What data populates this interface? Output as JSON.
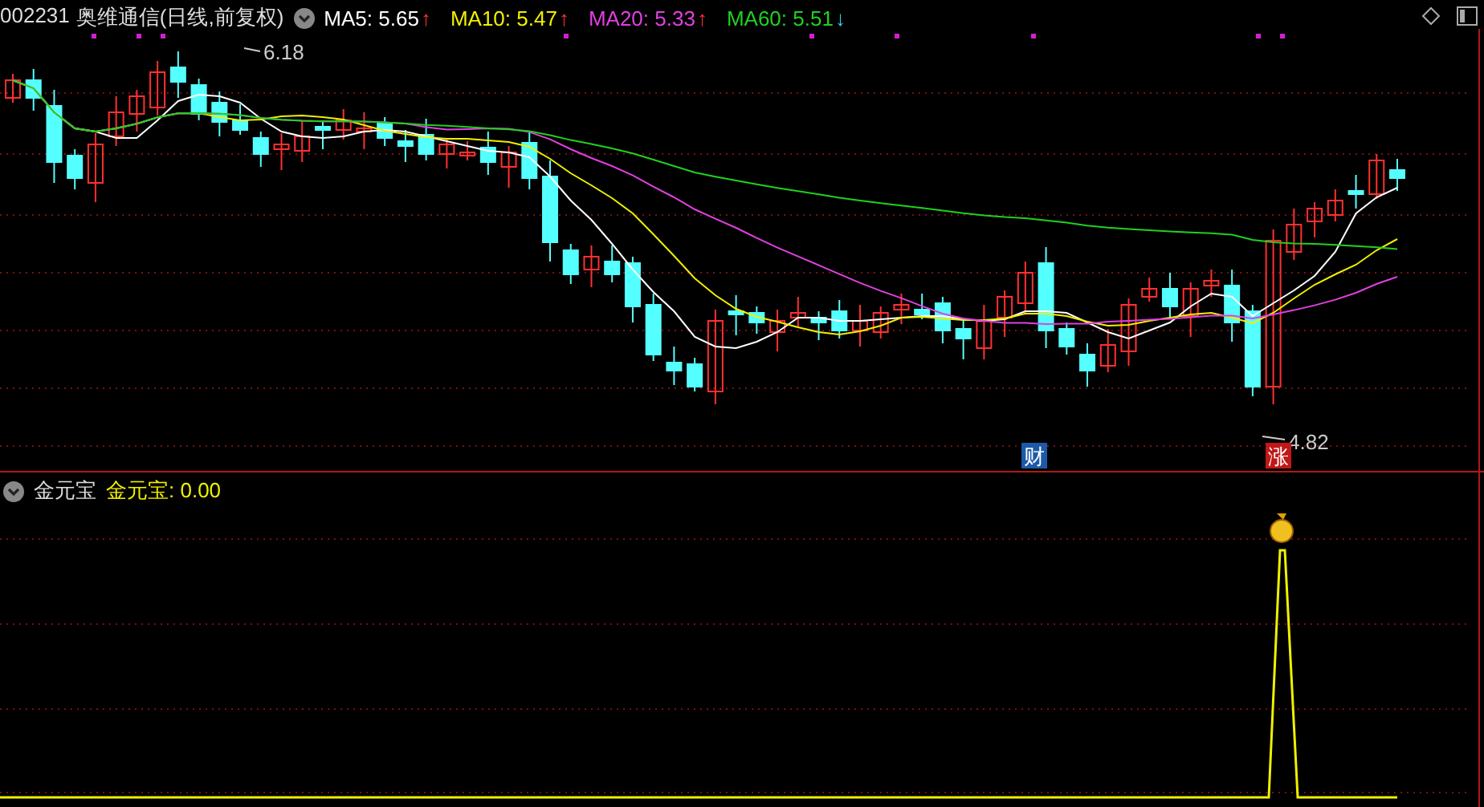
{
  "header": {
    "code": "002231",
    "name": "奥维通信",
    "period": "(日线,前复权)",
    "indicators": [
      {
        "label": "MA5: 5.65",
        "color": "#ffffff",
        "arrow": {
          "symbol": "↑",
          "color": "#ff3030"
        }
      },
      {
        "label": "MA10: 5.47",
        "color": "#f0f000",
        "arrow": {
          "symbol": "↑",
          "color": "#ff3030"
        }
      },
      {
        "label": "MA20: 5.33",
        "color": "#e040e0",
        "arrow": {
          "symbol": "↑",
          "color": "#ff3030"
        }
      },
      {
        "label": "MA60: 5.51",
        "color": "#20d020",
        "arrow": {
          "symbol": "↓",
          "color": "#30d0f0"
        }
      }
    ]
  },
  "price_chart": {
    "high_label": "6.18",
    "low_label": "4.82",
    "markers": [
      {
        "text": "财",
        "kind": "finance"
      },
      {
        "text": "涨",
        "kind": "limit_up"
      }
    ]
  },
  "indicator_panel": {
    "name": "金元宝",
    "value_label": "金元宝: 0.00"
  }
}
